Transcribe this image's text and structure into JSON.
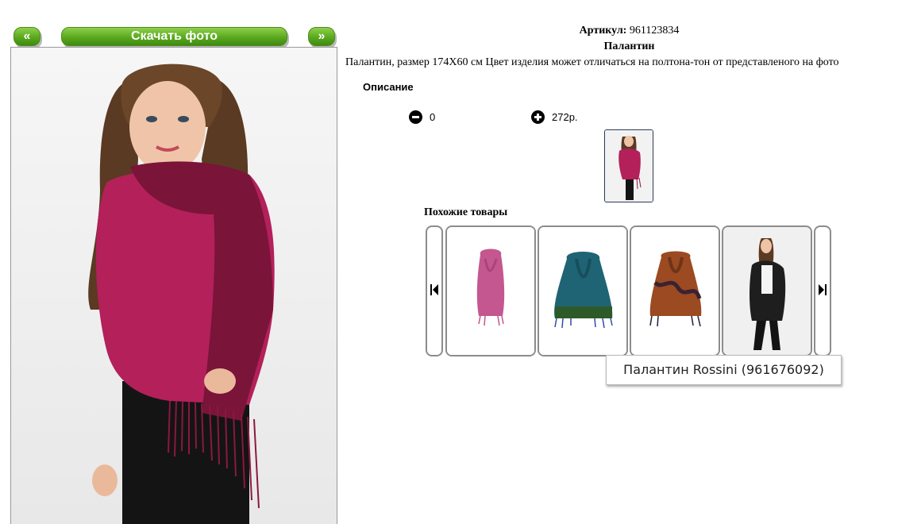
{
  "nav": {
    "prev_label": "«",
    "download_label": "Скачать фото",
    "next_label": "»"
  },
  "product": {
    "article_label": "Артикул:",
    "article_value": "961123834",
    "name": "Палантин",
    "description": "Палантин, размер 174Х60 см Цвет изделия может отличаться на полтона-тон от представленого на фото",
    "description_header": "Описание",
    "quantity": "0",
    "price": "272р."
  },
  "similar": {
    "title": "Похожие товары",
    "items": [
      {
        "color": "#c4578f"
      },
      {
        "color": "#1f6474"
      },
      {
        "color": "#9b4a22"
      },
      {
        "color": "#1e1e1e"
      }
    ]
  },
  "tooltip": {
    "text": "Палантин Rossini (961676092)"
  },
  "colors": {
    "button_green": "#5aa81f",
    "scarf_primary": "#b3205a",
    "scarf_dark": "#7a1439"
  }
}
